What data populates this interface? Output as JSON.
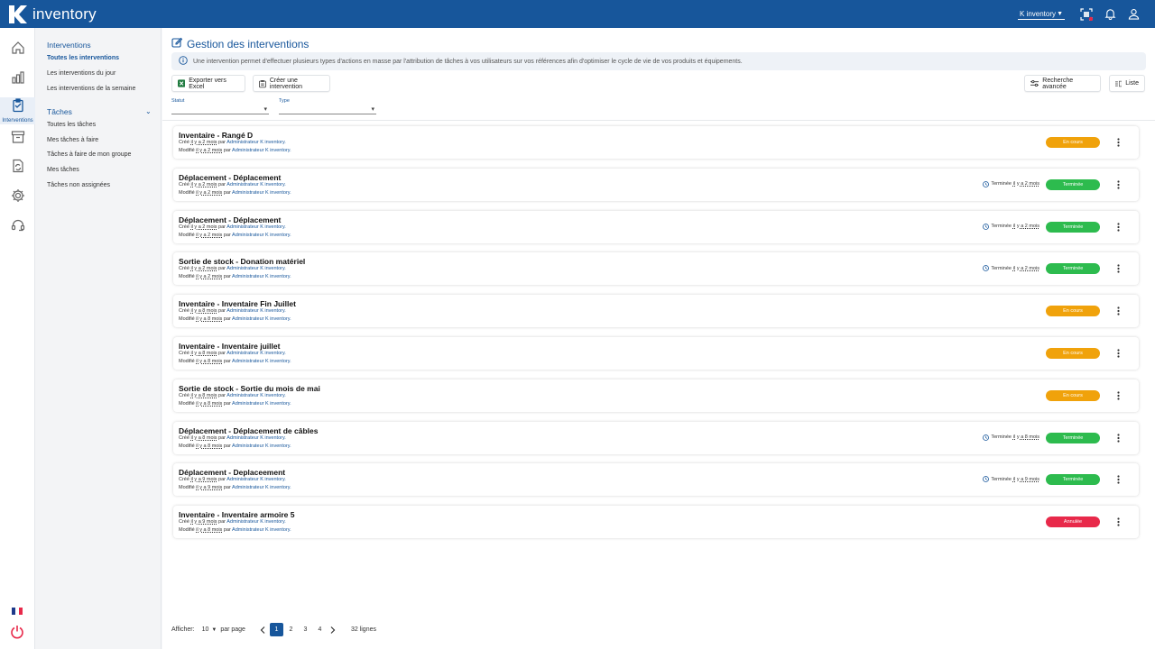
{
  "header": {
    "brand_name": "inventory",
    "instance": "K inventory"
  },
  "rail": {
    "active_label": "Interventions"
  },
  "subnav": {
    "interventions_heading": "Interventions",
    "links": [
      "Toutes les interventions",
      "Les interventions du jour",
      "Les interventions de la semaine"
    ],
    "taches_heading": "Tâches",
    "task_links": [
      "Toutes les tâches",
      "Mes tâches à faire",
      "Tâches à faire de mon groupe",
      "Mes tâches",
      "Tâches non assignées"
    ]
  },
  "main": {
    "title": "Gestion des interventions",
    "info": "Une intervention permet d'effectuer plusieurs types d'actions en masse par l'attribution de tâches à vos utilisateurs sur vos références afin d'optimiser le cycle de vie de vos produits et équipements.",
    "export_label": "Exporter vers Excel",
    "create_label": "Créer une intervention",
    "advanced_search_label": "Recherche avancée",
    "view_label": "Liste",
    "filters": {
      "status_label": "Statut",
      "type_label": "Type"
    }
  },
  "labels": {
    "created": "Créé",
    "modified": "Modifié",
    "by": "par",
    "completed": "Terminée"
  },
  "status_colors": {
    "En cours": "#f0a20b",
    "Terminée": "#2dbb4e",
    "Annulée": "#e8294a"
  },
  "interventions": [
    {
      "title": "Inventaire - Rangé D",
      "created_ago": "il y a 2 mois",
      "created_by": "Administrateur K inventory.",
      "modified_ago": "il y a 2 mois",
      "modified_by": "Administrateur K inventory.",
      "completed_ago": "",
      "status": "En cours"
    },
    {
      "title": "Déplacement - Déplacement",
      "created_ago": "il y a 2 mois",
      "created_by": "Administrateur K inventory.",
      "modified_ago": "il y a 2 mois",
      "modified_by": "Administrateur K inventory.",
      "completed_ago": "il y a 2 mois",
      "status": "Terminée"
    },
    {
      "title": "Déplacement - Déplacement",
      "created_ago": "il y a 2 mois",
      "created_by": "Administrateur K inventory.",
      "modified_ago": "il y a 2 mois",
      "modified_by": "Administrateur K inventory.",
      "completed_ago": "il y a 2 mois",
      "status": "Terminée"
    },
    {
      "title": "Sortie de stock - Donation matériel",
      "created_ago": "il y a 2 mois",
      "created_by": "Administrateur K inventory.",
      "modified_ago": "il y a 2 mois",
      "modified_by": "Administrateur K inventory.",
      "completed_ago": "il y a 2 mois",
      "status": "Terminée"
    },
    {
      "title": "Inventaire - Inventaire Fin Juillet",
      "created_ago": "il y a 8 mois",
      "created_by": "Administrateur K inventory.",
      "modified_ago": "il y a 8 mois",
      "modified_by": "Administrateur K inventory.",
      "completed_ago": "",
      "status": "En cours"
    },
    {
      "title": "Inventaire - Inventaire juillet",
      "created_ago": "il y a 8 mois",
      "created_by": "Administrateur K inventory.",
      "modified_ago": "il y a 8 mois",
      "modified_by": "Administrateur K inventory.",
      "completed_ago": "",
      "status": "En cours"
    },
    {
      "title": "Sortie de stock - Sortie du mois de mai",
      "created_ago": "il y a 8 mois",
      "created_by": "Administrateur K inventory.",
      "modified_ago": "il y a 8 mois",
      "modified_by": "Administrateur K inventory.",
      "completed_ago": "",
      "status": "En cours"
    },
    {
      "title": "Déplacement - Déplacement de câbles",
      "created_ago": "il y a 8 mois",
      "created_by": "Administrateur K inventory.",
      "modified_ago": "il y a 8 mois",
      "modified_by": "Administrateur K inventory.",
      "completed_ago": "il y a 8 mois",
      "status": "Terminée"
    },
    {
      "title": "Déplacement - Deplaceement",
      "created_ago": "il y a 9 mois",
      "created_by": "Administrateur K inventory.",
      "modified_ago": "il y a 9 mois",
      "modified_by": "Administrateur K inventory.",
      "completed_ago": "il y a 9 mois",
      "status": "Terminée"
    },
    {
      "title": "Inventaire - Inventaire armoire 5",
      "created_ago": "il y a 9 mois",
      "created_by": "Administrateur K inventory.",
      "modified_ago": "il y a 8 mois",
      "modified_by": "Administrateur K inventory.",
      "completed_ago": "",
      "status": "Annulée"
    }
  ],
  "pagination": {
    "show_label": "Afficher:",
    "page_size": "10",
    "per_page_label": "par page",
    "pages": [
      "1",
      "2",
      "3",
      "4"
    ],
    "current_page": "1",
    "total": "32 lignes"
  }
}
